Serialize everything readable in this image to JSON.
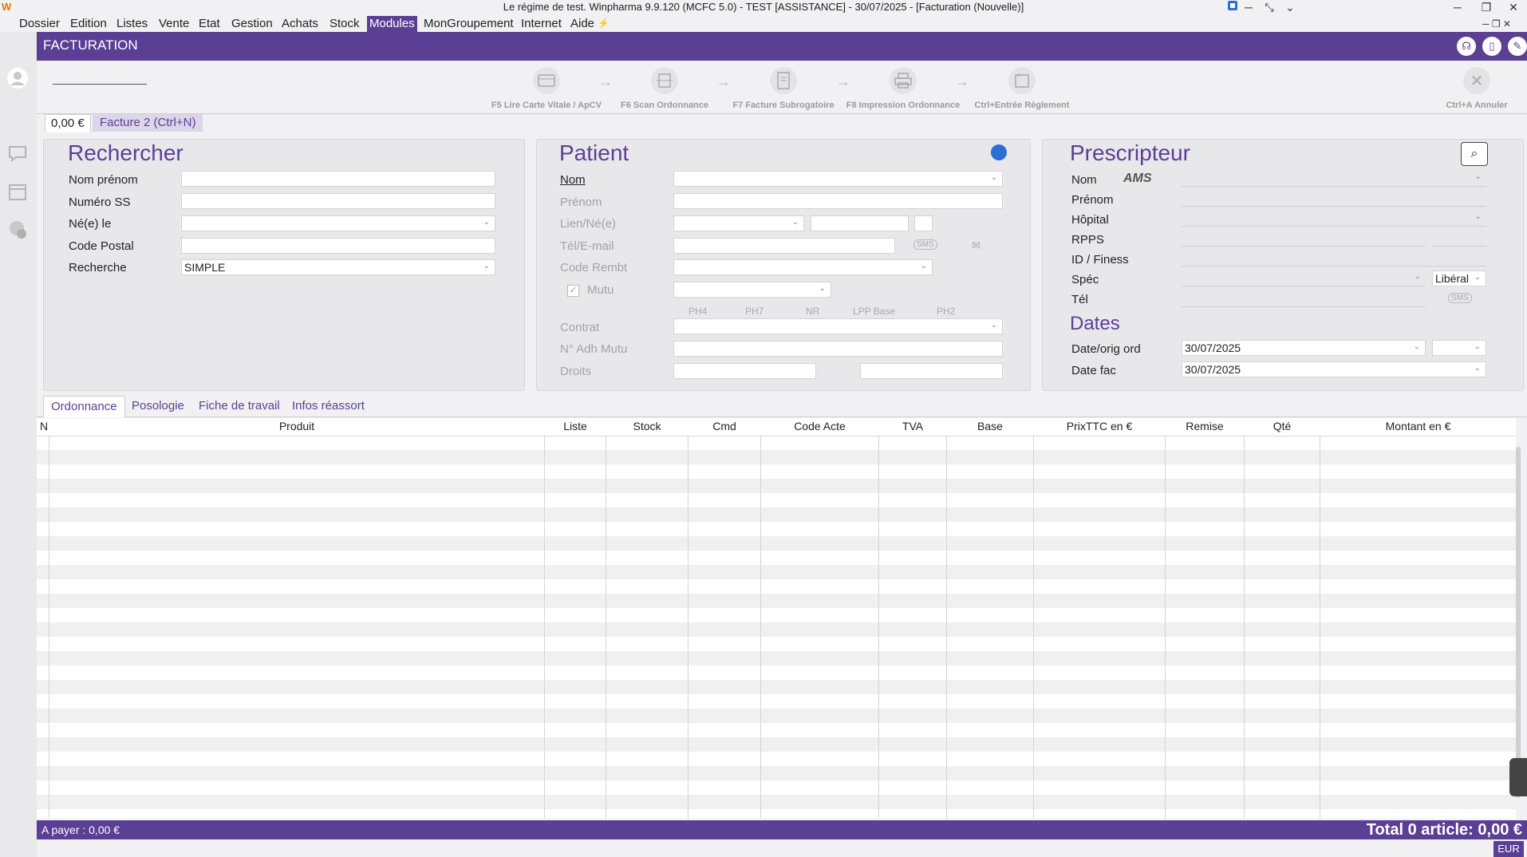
{
  "window": {
    "title": "Le régime de test. Winpharma 9.9.120  (MCFC 5.0) - TEST [ASSISTANCE] - 30/07/2025 - [Facturation (Nouvelle)]"
  },
  "menu": [
    "Dossier",
    "Edition",
    "Listes",
    "Vente",
    "Etat",
    "Gestion",
    "Achats",
    "Stock",
    "Modules",
    "MonGroupement",
    "Internet",
    "Aide"
  ],
  "menu_active": "Modules",
  "header": {
    "title": "FACTURATION"
  },
  "toolbar": {
    "actions": [
      {
        "label": "F5 Lire Carte Vitale / ApCV",
        "icon": "card-reader-icon"
      },
      {
        "label": "F6 Scan Ordonnance",
        "icon": "scan-icon"
      },
      {
        "label": "F7 Facture Subrogatoire",
        "icon": "document-icon"
      },
      {
        "label": "F8 Impression Ordonnance",
        "icon": "printer-icon"
      },
      {
        "label": "Ctrl+Entrée Règlement",
        "icon": "payment-icon"
      }
    ],
    "cancel_label": "Ctrl+A Annuler"
  },
  "invoice_tabs": {
    "amount": "0,00 €",
    "facture": "Facture 2 (Ctrl+N)"
  },
  "rechercher": {
    "title": "Rechercher",
    "fields": [
      "Nom prénom",
      "Numéro SS",
      "Né(e) le",
      "Code Postal",
      "Recherche"
    ],
    "recherche_value": "SIMPLE"
  },
  "patient": {
    "title": "Patient",
    "labels": {
      "nom": "Nom",
      "prenom": "Prénom",
      "lien": "Lien/Né(e)",
      "tel": "Tél/E-mail",
      "code_rembt": "Code Rembt",
      "mutu": "Mutu",
      "contrat": "Contrat",
      "n_adh": "N° Adh Mutu",
      "droits": "Droits"
    },
    "sms": "SMS",
    "mutu_columns": [
      "PH4",
      "PH7",
      "NR",
      "LPP Base",
      "PH2"
    ]
  },
  "prescripteur": {
    "title": "Prescripteur",
    "labels": {
      "nom": "Nom",
      "prenom": "Prénom",
      "hopital": "Hôpital",
      "rpps": "RPPS",
      "finess": "ID / Finess",
      "spec": "Spéc",
      "tel": "Tél"
    },
    "ams": "AMS",
    "liberal": "Libéral",
    "sms": "SMS"
  },
  "dates": {
    "title": "Dates",
    "date_orig_label": "Date/orig ord",
    "date_orig_value": "30/07/2025",
    "date_fac_label": "Date fac",
    "date_fac_value": "30/07/2025"
  },
  "subtabs": [
    "Ordonnance",
    "Posologie",
    "Fiche de travail",
    "Infos réassort"
  ],
  "subtab_active": "Ordonnance",
  "grid": {
    "columns": [
      "N",
      "Produit",
      "Liste",
      "Stock",
      "Cmd",
      "Code Acte",
      "TVA",
      "Base",
      "PrixTTC en €",
      "Remise",
      "Qté",
      "Montant en €"
    ]
  },
  "footer": {
    "a_payer": "A payer :  0,00 €",
    "total": "Total 0 article:  0,00 €",
    "currency": "EUR"
  },
  "colors": {
    "accent": "#5b3f94",
    "background": "#f1f0f2"
  }
}
